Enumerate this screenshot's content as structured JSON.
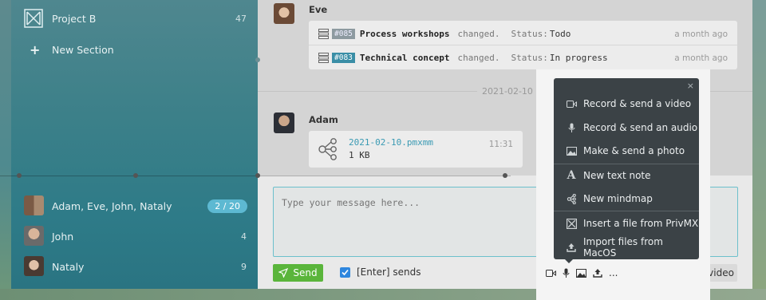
{
  "sidebar": {
    "project": {
      "label": "Project B",
      "count": "47"
    },
    "new_section": "New Section",
    "chats": [
      {
        "label": "Adam,  Eve,  John,  Nataly",
        "badge": "2 / 20"
      },
      {
        "label": "John",
        "count": "4"
      },
      {
        "label": "Nataly",
        "count": "9"
      }
    ]
  },
  "messages": [
    {
      "author": "Eve",
      "tasks": [
        {
          "id": "#085",
          "title": "Process workshops",
          "verb": "changed.",
          "status_label": "Status:",
          "status": "Todo",
          "time": "a month ago"
        },
        {
          "id": "#083",
          "title": "Technical concept",
          "verb": "changed.",
          "status_label": "Status:",
          "status": "In progress",
          "time": "a month ago"
        }
      ]
    },
    {
      "author": "Adam",
      "file": {
        "name": "2021-02-10.pmxmm",
        "size": "1 KB",
        "time": "11:31"
      }
    }
  ],
  "date_separator": "2021-02-10",
  "composer": {
    "placeholder": "Type your message here...",
    "send_label": "Send",
    "enter_sends_label": "[Enter] sends",
    "enter_sends_checked": true,
    "more_label": "...",
    "start_video_label": "Start video"
  },
  "attach_menu": {
    "close": "×",
    "items": [
      {
        "icon": "video-camera-icon",
        "label": "Record & send a video"
      },
      {
        "icon": "microphone-icon",
        "label": "Record & send an audio"
      },
      {
        "icon": "image-icon",
        "label": "Make & send a photo"
      },
      {
        "icon": "text-note-icon",
        "label": "New text note"
      },
      {
        "icon": "mindmap-icon",
        "label": "New mindmap"
      },
      {
        "icon": "privmx-logo-icon",
        "label": "Insert a file from PrivMX"
      },
      {
        "icon": "upload-icon",
        "label": "Import files from MacOS"
      }
    ]
  },
  "colors": {
    "accent": "#3a8ea6",
    "send": "#5ab53b",
    "menu_bg": "#3b4246",
    "sidebar": "#2e7b88"
  }
}
